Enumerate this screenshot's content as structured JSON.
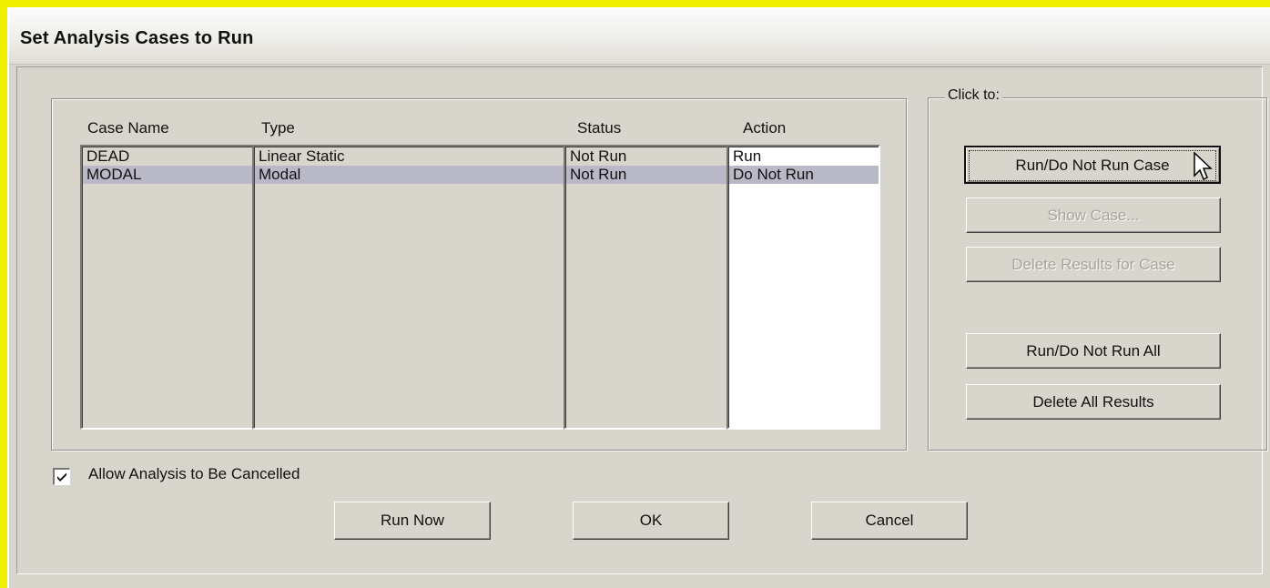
{
  "window": {
    "title": "Set Analysis Cases to Run"
  },
  "cases": {
    "columns": {
      "case_name": "Case Name",
      "type": "Type",
      "status": "Status",
      "action": "Action"
    },
    "rows": [
      {
        "case_name": "DEAD",
        "type": "Linear Static",
        "status": "Not Run",
        "action": "Run",
        "selected": false
      },
      {
        "case_name": "MODAL",
        "type": "Modal",
        "status": "Not Run",
        "action": "Do Not Run",
        "selected": true
      }
    ]
  },
  "click_to": {
    "label": "Click to:",
    "run_do_not_run_case": "Run/Do Not Run Case",
    "show_case": "Show Case...",
    "delete_results_for_case": "Delete Results for Case",
    "run_do_not_run_all": "Run/Do Not Run All",
    "delete_all_results": "Delete All Results"
  },
  "options": {
    "allow_cancel_label": "Allow Analysis to Be Cancelled",
    "allow_cancel_checked": true
  },
  "footer": {
    "run_now": "Run Now",
    "ok": "OK",
    "cancel": "Cancel"
  },
  "colors": {
    "background": "#f0f000",
    "dialog": "#d8d5cc",
    "selection": "#b9b8c6"
  }
}
